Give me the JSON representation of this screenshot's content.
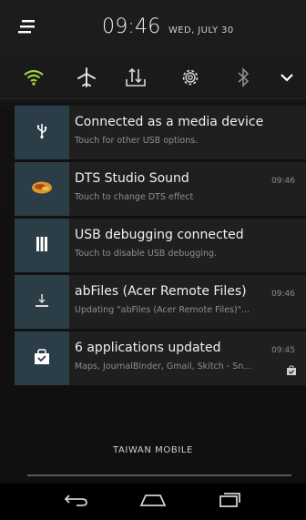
{
  "status": {
    "time": "09:46",
    "date": "WED, JULY 30"
  },
  "quick_settings": [
    {
      "icon": "wifi-icon",
      "active": true
    },
    {
      "icon": "airplane-icon",
      "active": false
    },
    {
      "icon": "data-transfer-icon",
      "active": false
    },
    {
      "icon": "settings-icon",
      "active": false
    },
    {
      "icon": "bluetooth-icon",
      "active": false
    },
    {
      "icon": "chevron-down-icon",
      "active": false
    }
  ],
  "notifications": [
    {
      "title": "Connected as a media device",
      "subtitle": "Touch for other USB options.",
      "time": "",
      "icon": "usb-icon"
    },
    {
      "title": "DTS Studio Sound",
      "subtitle": "Touch to change DTS effect",
      "time": "09:46",
      "icon": "dts-icon"
    },
    {
      "title": "USB debugging connected",
      "subtitle": "Touch to disable USB debugging.",
      "time": "",
      "icon": "usb-debug-icon"
    },
    {
      "title": "abFiles (Acer Remote Files)",
      "subtitle": "Updating \"abFiles (Acer Remote Files)\"...",
      "time": "09:46",
      "icon": "download-icon"
    },
    {
      "title": "6 applications updated",
      "subtitle": "Maps, JournalBinder, Gmail, Skitch - Sn...",
      "time": "09:45",
      "icon": "play-store-bag-icon"
    }
  ],
  "carrier": "TAIWAN MOBILE",
  "colors": {
    "accent_wifi": "#9bd13a",
    "icon_box": "#2b3d46"
  }
}
